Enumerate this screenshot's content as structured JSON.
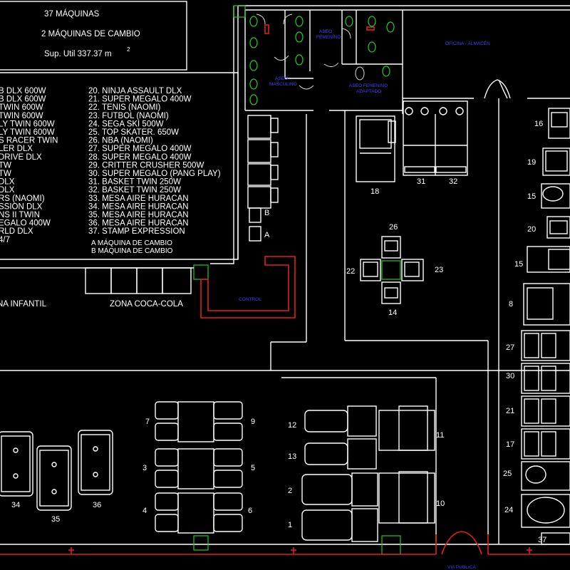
{
  "header": {
    "count_total": "37 MÁQUINAS",
    "count_change": "2 MÁQUINAS DE CAMBIO",
    "surface": "Sup. Util 337.37 m",
    "surface_exp": "2"
  },
  "legend_left": [
    "B DLX 600W",
    "B DLX 600W",
    "TWIN 600W",
    "TWIN 600W",
    "LY TWIN 600W",
    "LY TWIN 600W",
    "S RACER TWIN",
    "LER DLX",
    "DRIVE DLX",
    "TW",
    "TW",
    "DLX",
    "DLX",
    "RS (NAOMI)",
    "SSION DLX",
    "NS II TWIN",
    "EGALO 400W",
    "RLD DLX",
    "4/7"
  ],
  "legend_right": [
    "20. NINJA ASSAULT DLX",
    "21. SUPER MEGALO 400W",
    "22. TENIS (NAOMI)",
    "23. FUTBOL (NAOMI)",
    "24. SEGA SKI 500W",
    "25. TOP SKATER. 650W",
    "26. NBA (NAOMI)",
    "27. SUPER MEGALO 400W",
    "28. SUPER MEGALO 400W",
    "29. CRITTER CRUSHER 500W",
    "30. SUPER MEGALO (PANG PLAY)",
    "31. BASKET TWIN 250W",
    "32. BASKET TWIN 250W",
    "33.   MESA AIRE HURACAN",
    "34.   MESA AIRE HURACAN",
    "35.   MESA AIRE HURACAN",
    "36.   MESA AIRE HURACAN",
    "37. STAMP EXPRESSION"
  ],
  "legend_change": [
    "A MÁQUINA DE CAMBIO",
    "B MÁQUINA DE CAMBIO"
  ],
  "zones": {
    "infantil": "NA INFANTIL",
    "coca_cola": "ZONA COCA-COLA",
    "control": "CONTROL",
    "oficina": "OFICINA - ALMACÉN",
    "via_publica": "VIA PUBLICA"
  },
  "rooms": {
    "aseo_fem": [
      "ASEO",
      "FEMENINO"
    ],
    "aseo_masc": [
      "ASEO",
      "MASCULINO"
    ],
    "aseo_fem_adapt": [
      "ASEO FEMENINO",
      "ADAPTADO"
    ]
  },
  "change_labels": [
    "B",
    "A"
  ],
  "machine_numbers": {
    "n18": "18",
    "n31": "31",
    "n32": "32",
    "n26": "26",
    "n22": "22",
    "n23": "23",
    "n14": "14",
    "n16": "16",
    "n19": "19",
    "n15a": "15",
    "n20": "20",
    "n15b": "15",
    "n8": "8",
    "n27": "27",
    "n30": "30",
    "n21": "21",
    "n17": "17",
    "n25": "25",
    "n24": "24",
    "n37": "37",
    "n7": "7",
    "n9": "9",
    "n3": "3",
    "n5": "5",
    "n4": "4",
    "n6": "6",
    "n12": "12",
    "n13": "13",
    "n2": "2",
    "n1": "1",
    "n11": "11",
    "n10": "10",
    "n34": "34",
    "n35": "35",
    "n36": "36"
  }
}
